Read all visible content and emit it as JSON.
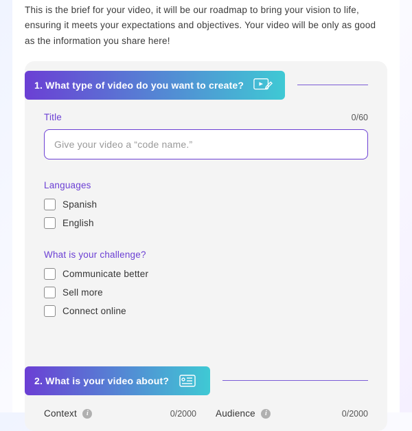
{
  "intro": "This is the brief for your video, it will be our roadmap to bring your vision to life, ensuring it meets your expectations and objectives. Your video will be only as good as the information you share here!",
  "section1": {
    "title": "1. What type of video do you want to create?",
    "titleField": {
      "label": "Title",
      "counter": "0/60",
      "placeholder": "Give your video a “code name.”"
    },
    "languages": {
      "label": "Languages",
      "options": [
        "Spanish",
        "English"
      ]
    },
    "challenge": {
      "label": "What is your challenge?",
      "options": [
        "Communicate better",
        "Sell more",
        "Connect online"
      ]
    }
  },
  "section2": {
    "title": "2. What is your video about?",
    "context": {
      "label": "Context",
      "counter": "0/2000"
    },
    "audience": {
      "label": "Audience",
      "counter": "0/2000"
    }
  }
}
